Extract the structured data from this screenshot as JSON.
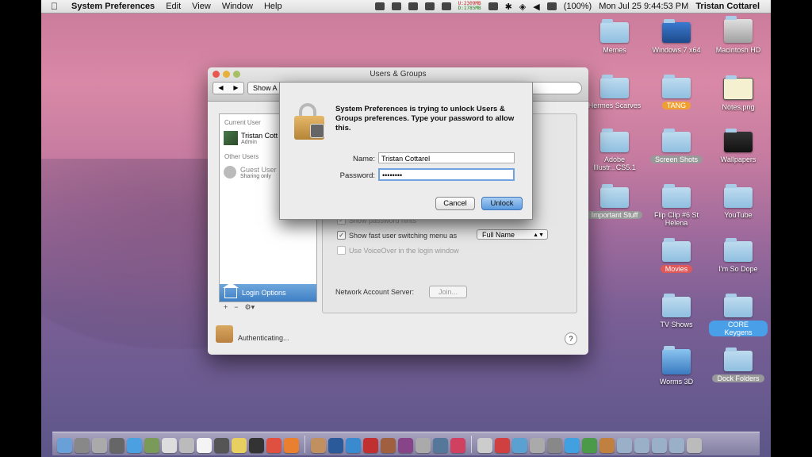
{
  "menubar": {
    "app_name": "System Preferences",
    "menus": [
      "Edit",
      "View",
      "Window",
      "Help"
    ],
    "net_up": "U:2309MB",
    "net_down": "D:1785MB",
    "battery": "(100%)",
    "datetime": "Mon Jul 25  9:44:53 PM",
    "user": "Tristan Cottarel"
  },
  "desktop_icons": [
    {
      "label": "Memes",
      "tag": ""
    },
    {
      "label": "Windows 7 x64",
      "tag": ""
    },
    {
      "label": "Macintosh HD",
      "tag": ""
    },
    {
      "label": "Hermes Scarves",
      "tag": ""
    },
    {
      "label": "TANG",
      "tag": "orange"
    },
    {
      "label": "Notes.png",
      "tag": ""
    },
    {
      "label": "Adobe Illustr...CS5.1",
      "tag": ""
    },
    {
      "label": "Screen Shots",
      "tag": "gray"
    },
    {
      "label": "Wallpapers",
      "tag": ""
    },
    {
      "label": "Important Stuff",
      "tag": "gray"
    },
    {
      "label": "Flip Clip #6 St Helena",
      "tag": ""
    },
    {
      "label": "YouTube",
      "tag": ""
    },
    {
      "label": "Movies",
      "tag": "red"
    },
    {
      "label": "I'm So Dope",
      "tag": ""
    },
    {
      "label": "TV Shows",
      "tag": ""
    },
    {
      "label": "CORE Keygens",
      "tag": "blue"
    },
    {
      "label": "Worms 3D",
      "tag": ""
    },
    {
      "label": "Dock Folders",
      "tag": "gray"
    }
  ],
  "window": {
    "title": "Users & Groups",
    "show_all": "Show A",
    "current_user_header": "Current User",
    "current_user_name": "Tristan Cott",
    "current_user_role": "Admin",
    "other_users_header": "Other Users",
    "guest_name": "Guest User",
    "guest_sub": "Sharing only",
    "login_options": "Login Options",
    "show_password_hints": "Show password hints",
    "fast_user_switching": "Show fast user switching menu as",
    "fast_user_switching_value": "Full Name",
    "voiceover": "Use VoiceOver in the login window",
    "network_account_server": "Network Account Server:",
    "join": "Join...",
    "authenticating": "Authenticating...",
    "help": "?"
  },
  "sheet": {
    "message": "System Preferences is trying to unlock Users & Groups preferences. Type your password to allow this.",
    "name_label": "Name:",
    "name_value": "Tristan Cottarel",
    "password_label": "Password:",
    "password_value": "••••••••",
    "cancel": "Cancel",
    "unlock": "Unlock"
  },
  "colors": {
    "accent": "#5a9ae0",
    "selection": "#3e7fc4"
  }
}
